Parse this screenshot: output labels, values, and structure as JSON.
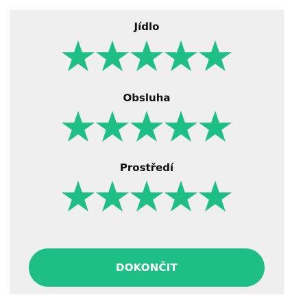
{
  "ratings": [
    {
      "label": "Jídlo",
      "stars_filled": 5,
      "stars_total": 5
    },
    {
      "label": "Obsluha",
      "stars_filled": 5,
      "stars_total": 5
    },
    {
      "label": "Prostředí",
      "stars_filled": 5,
      "stars_total": 5
    }
  ],
  "finish_button": {
    "label": "DOKONČIT"
  },
  "colors": {
    "accent": "#1dbf86",
    "background": "#efefef",
    "text": "#111111",
    "button_text": "#ffffff"
  },
  "icons": {
    "star": "star-icon"
  }
}
